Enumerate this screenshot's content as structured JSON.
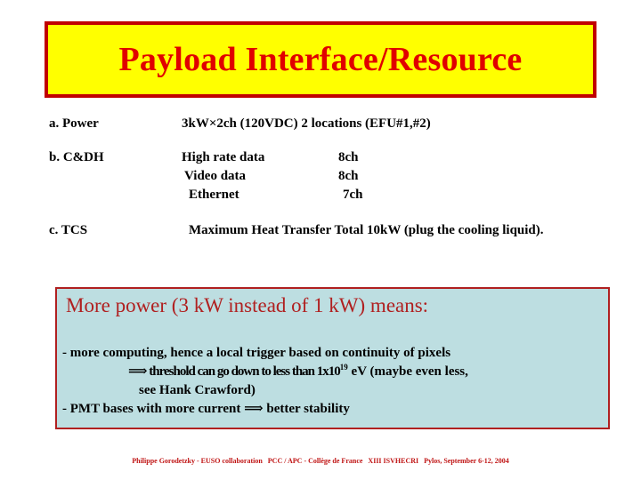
{
  "slide": {
    "title": "Payload Interface/Resource",
    "title_bg": "#ffff00",
    "title_border": "#c00000",
    "title_color": "#e00000"
  },
  "specs": [
    {
      "label": "a. Power",
      "value": "3kW×2ch (120VDC)  2 locations (EFU#1,#2)",
      "qty": ""
    },
    {
      "label": "b. C&DH",
      "value": "High rate data",
      "qty": "8ch"
    },
    {
      "label": "",
      "value": "Video data",
      "qty": "8ch"
    },
    {
      "label": "",
      "value": "Ethernet",
      "qty": "7ch"
    },
    {
      "label": "c. TCS",
      "value": "Maximum Heat Transfer Total 10kW (plug the cooling liquid).",
      "qty": ""
    }
  ],
  "note": {
    "heading": "More power (3 kW instead of 1 kW) means:",
    "bg": "#bddee1",
    "border": "#b02020",
    "heading_color": "#b02020",
    "lines": [
      "- more computing, hence a local trigger based on continuity of pixels",
      "⟹  threshold can go down to less than 1x10",
      "19",
      " eV (maybe even less,",
      "see Hank Crawford)",
      "- PMT bases with more current ⟹ better stability"
    ]
  },
  "footer": {
    "author": "Philippe Gorodetzky - EUSO collaboration",
    "affiliation": "PCC / APC - Collège de France",
    "conference": "XIII ISVHECRI",
    "venue_date": "Pylos, September 6-12, 2004",
    "color": "#c01515"
  }
}
